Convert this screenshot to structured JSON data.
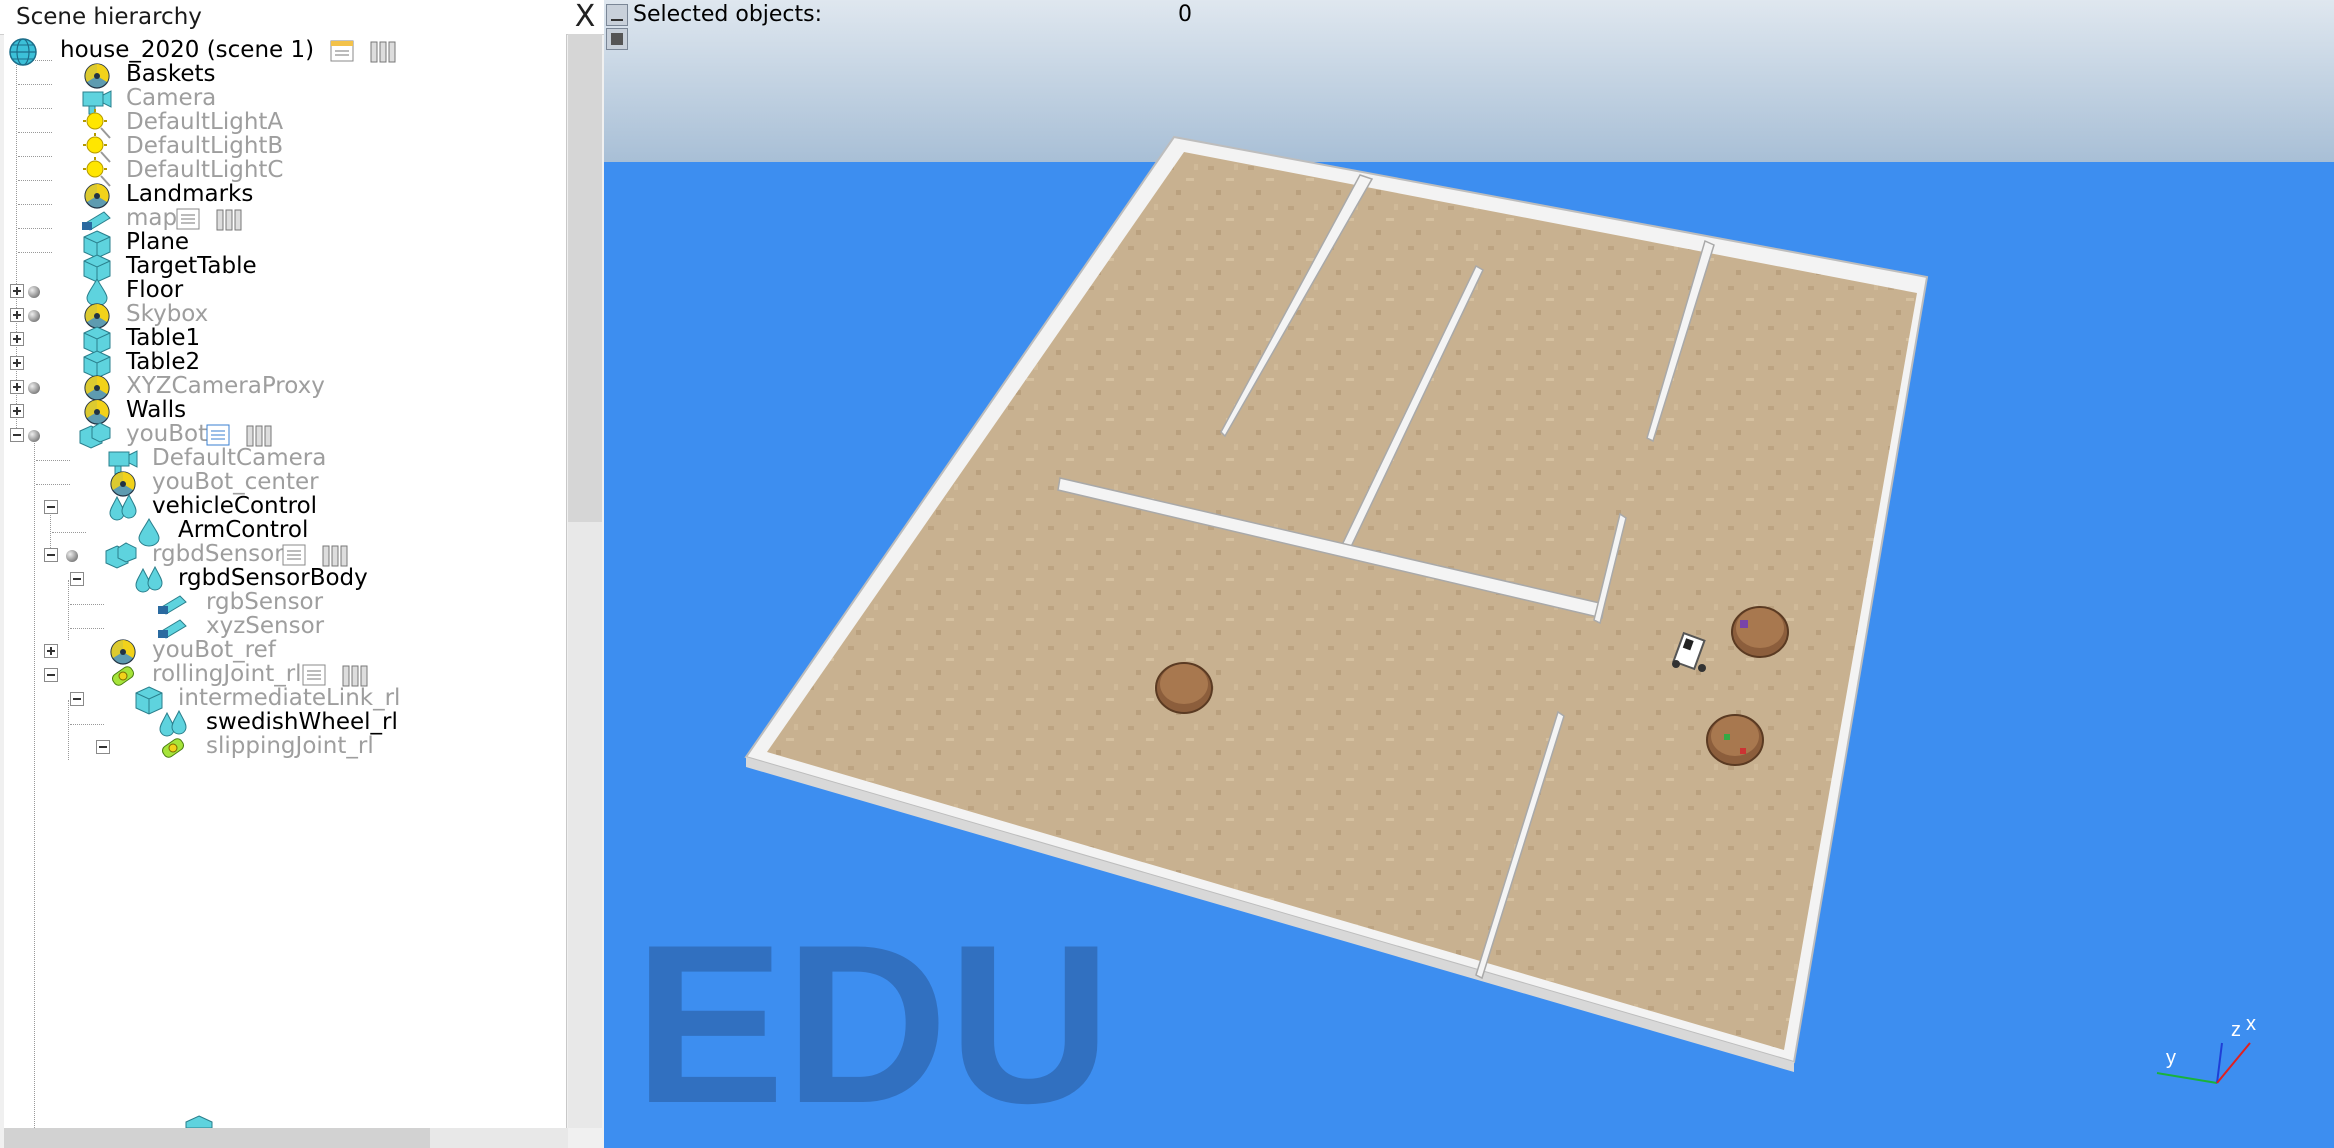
{
  "hierarchy": {
    "title": "Scene hierarchy",
    "close_glyph": "X",
    "items": [
      {
        "label": "house_2020 (scene 1)",
        "icon": "globe-icon",
        "enabled": true
      },
      {
        "label": "Baskets",
        "icon": "dummy-icon",
        "enabled": true
      },
      {
        "label": "Camera",
        "icon": "camera-icon",
        "enabled": false
      },
      {
        "label": "DefaultLightA",
        "icon": "light-icon",
        "enabled": false
      },
      {
        "label": "DefaultLightB",
        "icon": "light-icon",
        "enabled": false
      },
      {
        "label": "DefaultLightC",
        "icon": "light-icon",
        "enabled": false
      },
      {
        "label": "Landmarks",
        "icon": "dummy-icon",
        "enabled": true
      },
      {
        "label": "map",
        "icon": "sensor-icon",
        "enabled": false
      },
      {
        "label": "Plane",
        "icon": "shape-icon",
        "enabled": true
      },
      {
        "label": "TargetTable",
        "icon": "shape-icon",
        "enabled": true
      },
      {
        "label": "Floor",
        "icon": "shape-drop-icon",
        "enabled": true
      },
      {
        "label": "Skybox",
        "icon": "dummy-icon",
        "enabled": false
      },
      {
        "label": "Table1",
        "icon": "shape-icon",
        "enabled": true
      },
      {
        "label": "Table2",
        "icon": "shape-icon",
        "enabled": true
      },
      {
        "label": "XYZCameraProxy",
        "icon": "dummy-icon",
        "enabled": false
      },
      {
        "label": "Walls",
        "icon": "dummy-icon",
        "enabled": true
      },
      {
        "label": "youBot",
        "icon": "shape-group-icon",
        "enabled": false
      },
      {
        "label": "DefaultCamera",
        "icon": "camera-icon",
        "enabled": false
      },
      {
        "label": "youBot_center",
        "icon": "dummy-icon",
        "enabled": false
      },
      {
        "label": "vehicleControl",
        "icon": "shape-pair-icon",
        "enabled": true
      },
      {
        "label": "ArmControl",
        "icon": "shape-drop-icon",
        "enabled": true
      },
      {
        "label": "rgbdSensor",
        "icon": "shape-group-icon",
        "enabled": false
      },
      {
        "label": "rgbdSensorBody",
        "icon": "shape-pair-icon",
        "enabled": true
      },
      {
        "label": "rgbSensor",
        "icon": "sensor-icon",
        "enabled": false
      },
      {
        "label": "xyzSensor",
        "icon": "sensor-icon",
        "enabled": false
      },
      {
        "label": "youBot_ref",
        "icon": "dummy-icon",
        "enabled": false
      },
      {
        "label": "rollingJoint_rl",
        "icon": "joint-icon",
        "enabled": false
      },
      {
        "label": "intermediateLink_rl",
        "icon": "shape-icon",
        "enabled": false
      },
      {
        "label": "swedishWheel_rl",
        "icon": "shape-pair-icon",
        "enabled": true
      },
      {
        "label": "slippingJoint_rl",
        "icon": "joint-icon",
        "enabled": false
      }
    ]
  },
  "viewport": {
    "selected_label": "Selected objects:",
    "selected_count": "0",
    "watermark": "EDU",
    "axis_labels": {
      "x": "x",
      "y": "y",
      "z": "z"
    }
  },
  "colors": {
    "sky_top": "#b8c9da",
    "background_blue": "#3d8ef0",
    "floor": "#c8b190",
    "wall": "#f4f4f4",
    "watermark": "#2f6bb8",
    "icon_cyan": "#4fd1d9",
    "light_yellow": "#ffe600"
  }
}
